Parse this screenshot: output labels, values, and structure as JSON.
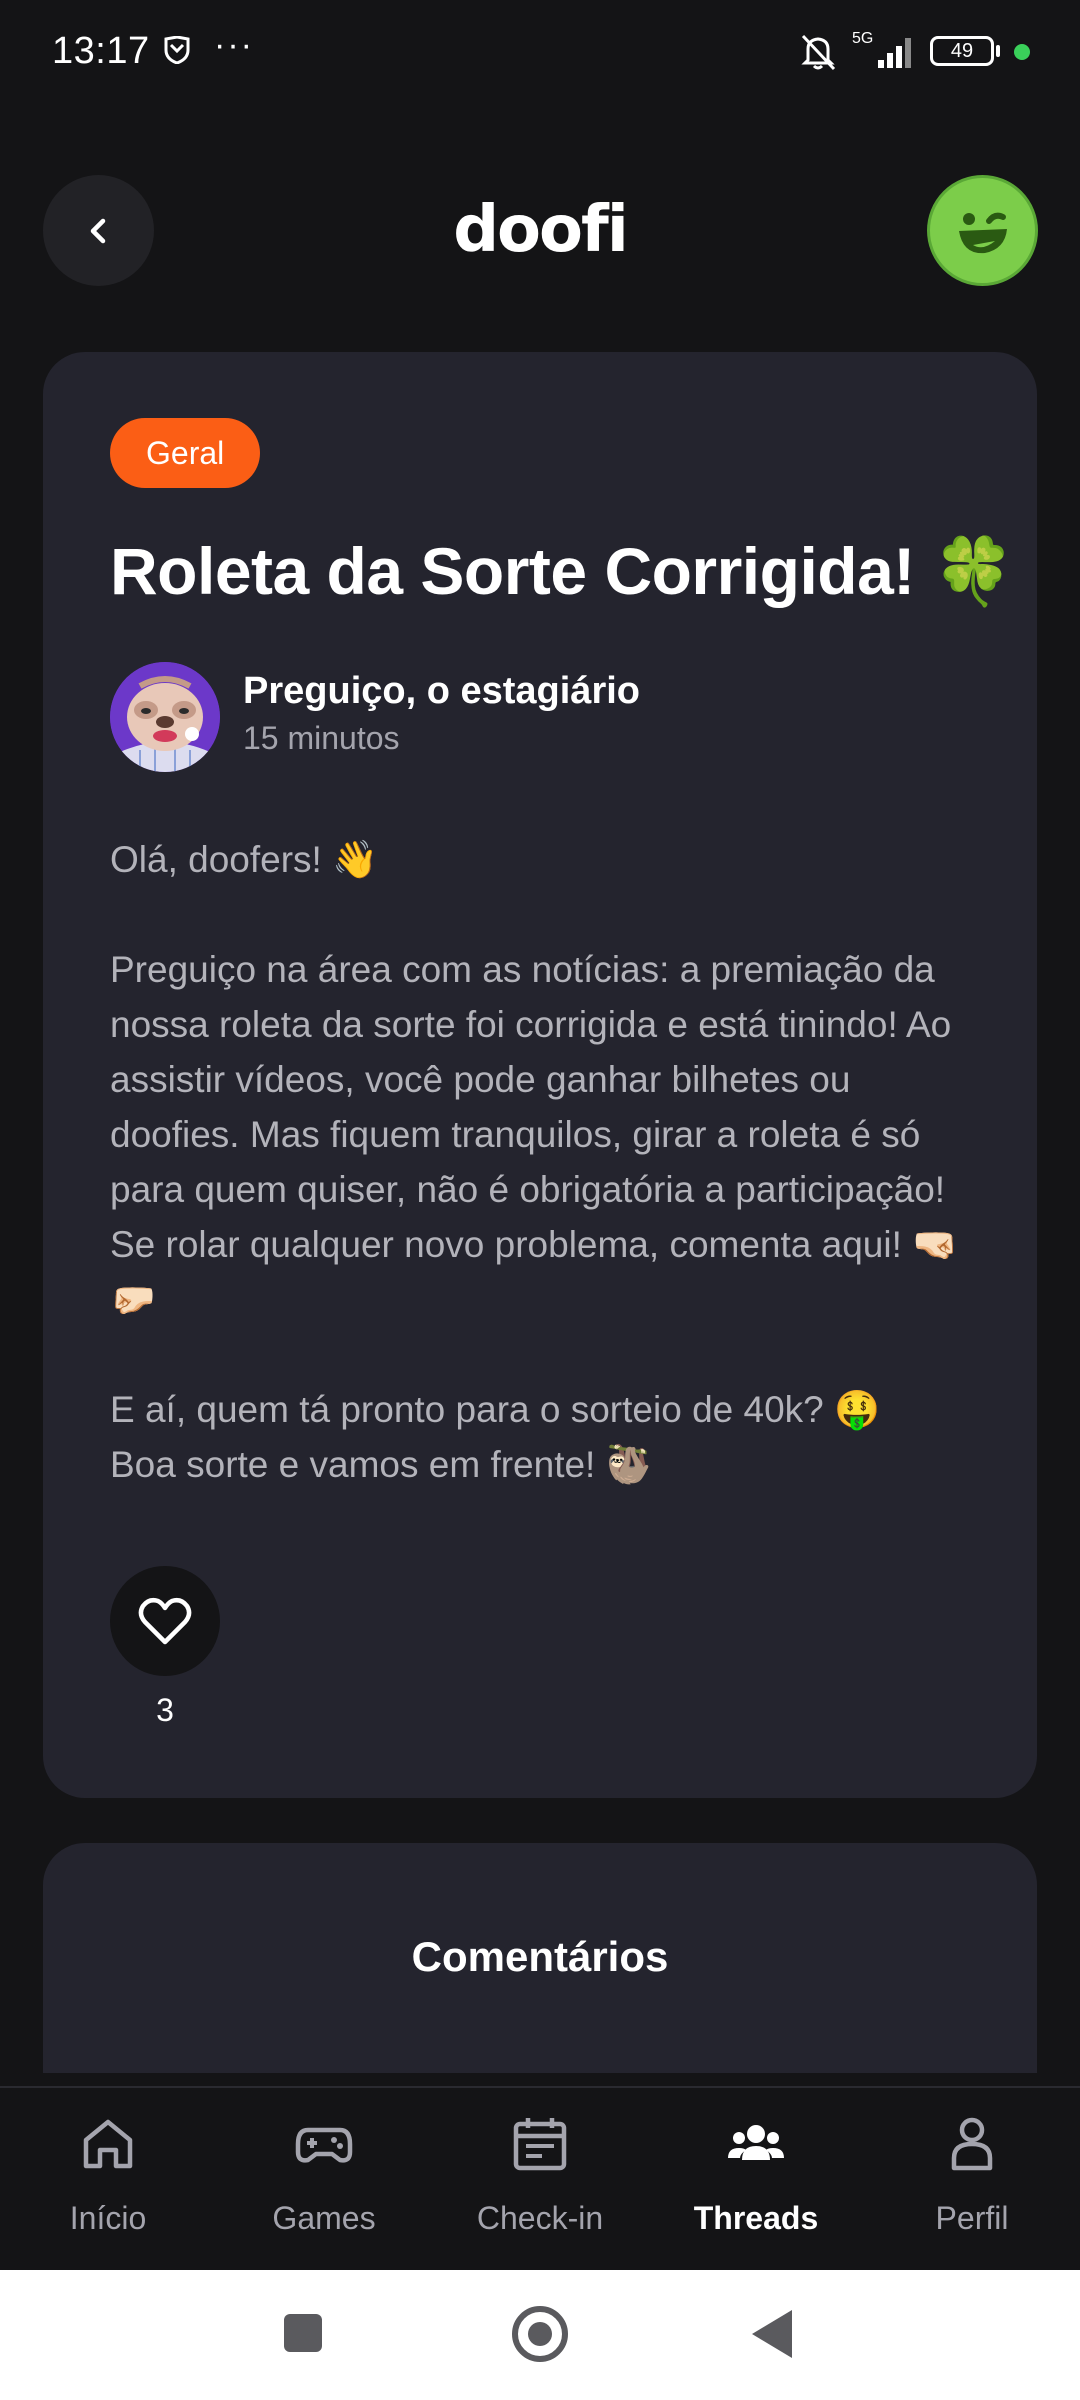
{
  "status_bar": {
    "time": "13:17",
    "network": "5G",
    "battery": "49",
    "icons": [
      "shield-icon",
      "more-dots-icon",
      "bell-muted-icon",
      "signal-icon",
      "battery-icon"
    ]
  },
  "header": {
    "logo": "doofi",
    "back_icon": "chevron-left-icon",
    "avatar_icon": "smiley-wink-icon",
    "avatar_color": "#7ccd4a"
  },
  "post": {
    "tag": "Geral",
    "tag_color": "#fb5e15",
    "title": "Roleta da Sorte Corrigida! 🍀",
    "author": {
      "name": "Preguiço, o estagiário",
      "time": "15 minutos"
    },
    "body": [
      "Olá, doofers! 👋",
      "Preguiço na área com as notícias: a premiação da nossa roleta da sorte foi corrigida e está tinindo! Ao assistir vídeos, você pode ganhar bilhetes ou doofies. Mas fiquem tranquilos, girar a roleta é só para quem quiser, não é obrigatória a participação! Se rolar qualquer novo problema, comenta aqui! 🤜🏻🤛🏻",
      "E aí, quem tá pronto para o sorteio de 40k? 🤑",
      "Boa sorte e vamos em frente! 🦥"
    ],
    "likes": "3"
  },
  "comments": {
    "title": "Comentários"
  },
  "bottom_nav": {
    "items": [
      {
        "label": "Início",
        "icon": "home-icon",
        "active": false
      },
      {
        "label": "Games",
        "icon": "gamepad-icon",
        "active": false
      },
      {
        "label": "Check-in",
        "icon": "calendar-icon",
        "active": false
      },
      {
        "label": "Threads",
        "icon": "users-icon",
        "active": true
      },
      {
        "label": "Perfil",
        "icon": "person-icon",
        "active": false
      }
    ]
  },
  "colors": {
    "background": "#141416",
    "card": "#24242e",
    "text_muted": "#b3b3ba"
  }
}
